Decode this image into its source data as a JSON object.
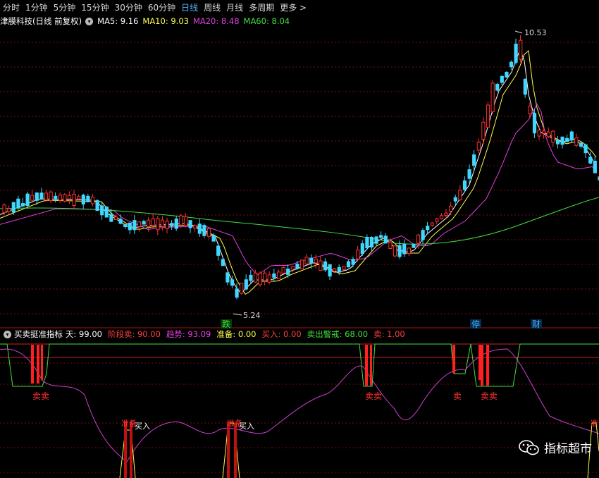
{
  "toolbar": {
    "tabs": [
      "分时",
      "1分钟",
      "5分钟",
      "15分钟",
      "30分钟",
      "60分钟",
      "日线",
      "周线",
      "月线",
      "多周期",
      "更多 >"
    ],
    "active_index": 6
  },
  "stock": {
    "name": "津膜科技(日线 前复权)",
    "ma": [
      {
        "label": "MA5: 9.16",
        "color": "#ffffff"
      },
      {
        "label": "MA10: 9.03",
        "color": "#ffff4d"
      },
      {
        "label": "MA20: 8.48",
        "color": "#e040e0"
      },
      {
        "label": "MA60: 8.04",
        "color": "#40e040"
      }
    ],
    "high_label": "10.53",
    "low_label": "5.24",
    "markers": [
      {
        "text": "跌",
        "color": "#40e040"
      },
      {
        "text": "停",
        "color": "#40b0ff"
      },
      {
        "text": "财",
        "color": "#40b0ff"
      }
    ]
  },
  "indicator": {
    "name": "买卖挺准指标",
    "values": [
      {
        "label": "天: 99.00",
        "color": "#ffffff"
      },
      {
        "label": "阶段卖: 90.00",
        "color": "#ff4040"
      },
      {
        "label": "趋势: 93.09",
        "color": "#e040e0"
      },
      {
        "label": "准备: 0.00",
        "color": "#ffff4d"
      },
      {
        "label": "买入: 0.00",
        "color": "#ff4040"
      },
      {
        "label": "卖出警戒: 68.00",
        "color": "#40e040"
      },
      {
        "label": "卖: 1.00",
        "color": "#ff4040"
      }
    ],
    "signals": {
      "sell_sell": "卖卖",
      "sell": "卖",
      "prepare": "准备",
      "buy": "买入"
    }
  },
  "watermark": "指标超市",
  "chart_data": {
    "type": "candlestick",
    "title": "津膜科技(日线 前复权)",
    "price_high": 10.53,
    "price_low": 5.24,
    "ma_last": {
      "MA5": 9.16,
      "MA10": 9.03,
      "MA20": 8.48,
      "MA60": 8.04
    },
    "colors": {
      "up": "#ff3030",
      "down": "#40d8ff",
      "grid": "#8b1010"
    }
  }
}
